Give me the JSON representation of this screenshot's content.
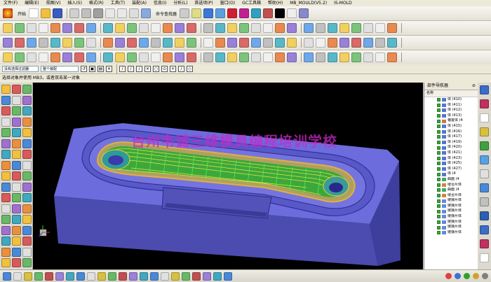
{
  "menubar": {
    "items": [
      "文件(F)",
      "编辑(E)",
      "视图(V)",
      "插入(S)",
      "格式(R)",
      "工具(T)",
      "装配(A)",
      "信息(I)",
      "分析(L)",
      "首选项(P)",
      "窗口(O)",
      "GC工具箱",
      "帮助(H)",
      "MB_MOULD(V5.2)",
      "IS-MOLD"
    ]
  },
  "toolbar": {
    "start_label": "开始",
    "command_finder_label": "命令查找器"
  },
  "selection": {
    "filter_value": "没有选择过滤器",
    "scope_value": "整个装配"
  },
  "cue": {
    "text": "选择对象并使用 MB3，或者双击某一对象"
  },
  "viewport": {
    "watermark": "台州韦诚三维模具编程培训学校",
    "colors": {
      "background": "#000000",
      "block_top": "#6b6bd9",
      "block_side": "#4c4cb0",
      "part_green": "#46d646",
      "toolpath": "#e6e63c"
    }
  },
  "navigator": {
    "title": "部件导航器",
    "column_header": "名称",
    "items": [
      {
        "label": "体 (410)",
        "icon": "body-icon"
      },
      {
        "label": "体 (411)",
        "icon": "body-icon"
      },
      {
        "label": "体 (412)",
        "icon": "body-icon"
      },
      {
        "label": "体 (413)",
        "icon": "body-icon"
      },
      {
        "label": "偏置体 (4",
        "icon": "offset-icon"
      },
      {
        "label": "体 (415)",
        "icon": "body-icon"
      },
      {
        "label": "体 (416)",
        "icon": "body-icon"
      },
      {
        "label": "体 (417)",
        "icon": "body-icon"
      },
      {
        "label": "体 (419)",
        "icon": "body-icon"
      },
      {
        "label": "体 (420)",
        "icon": "body-icon"
      },
      {
        "label": "体 (421)",
        "icon": "body-icon"
      },
      {
        "label": "体 (423)",
        "icon": "body-icon"
      },
      {
        "label": "体 (425)",
        "icon": "body-icon"
      },
      {
        "label": "体 (427)",
        "icon": "body-icon"
      },
      {
        "label": "体 (4",
        "icon": "body-icon"
      },
      {
        "label": "曲面 (4",
        "icon": "surface-icon"
      },
      {
        "label": "缝合片体",
        "icon": "sew-icon"
      },
      {
        "label": "曲面 (4",
        "icon": "surface-icon"
      },
      {
        "label": "缝合片体",
        "icon": "sew-icon"
      },
      {
        "label": "链接片体",
        "icon": "link-icon"
      },
      {
        "label": "链接片体",
        "icon": "link-icon"
      },
      {
        "label": "链接片体",
        "icon": "link-icon"
      },
      {
        "label": "链接片体",
        "icon": "link-icon"
      },
      {
        "label": "链接片体",
        "icon": "link-icon"
      },
      {
        "label": "链接片体",
        "icon": "link-icon"
      },
      {
        "label": "链接片体",
        "icon": "link-icon"
      }
    ]
  }
}
